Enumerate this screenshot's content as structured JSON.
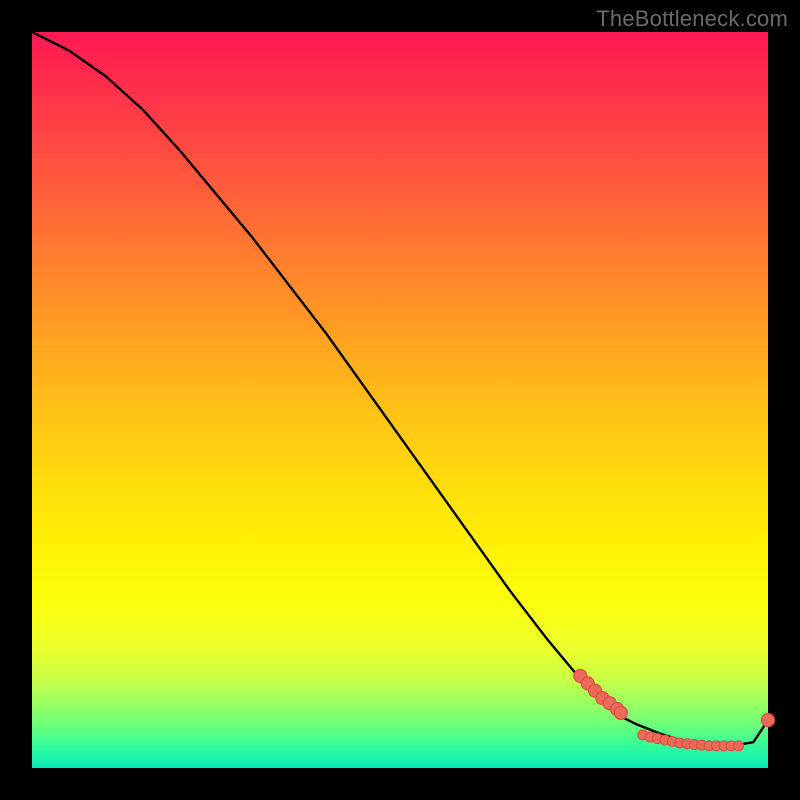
{
  "watermark": "TheBottleneck.com",
  "chart_data": {
    "type": "line",
    "title": "",
    "xlabel": "",
    "ylabel": "",
    "xlim": [
      0,
      100
    ],
    "ylim": [
      0,
      100
    ],
    "grid": false,
    "legend": false,
    "series": [
      {
        "name": "bottleneck-curve",
        "x": [
          0,
          5,
          10,
          15,
          20,
          25,
          30,
          35,
          40,
          45,
          50,
          55,
          60,
          65,
          70,
          75,
          78,
          80,
          82,
          85,
          88,
          90,
          92,
          95,
          98,
          100
        ],
        "y": [
          100,
          97.5,
          94,
          89.5,
          84,
          78,
          72,
          65.5,
          59,
          52,
          45,
          38,
          31,
          24,
          17.5,
          11.5,
          8.5,
          7,
          6,
          4.8,
          3.8,
          3.3,
          3,
          3,
          3.5,
          6.5
        ]
      }
    ],
    "points_cluster_a": {
      "name": "left-marker-cluster",
      "x": [
        74.5,
        75.5,
        76.5,
        77.5,
        78.5,
        79.5,
        80.0
      ],
      "y": [
        12.5,
        11.5,
        10.5,
        9.5,
        8.8,
        8.0,
        7.5
      ]
    },
    "points_cluster_b": {
      "name": "bottom-marker-cluster",
      "x": [
        83,
        84,
        85,
        86,
        87,
        88,
        89,
        90,
        91,
        92,
        93,
        94,
        95,
        96
      ],
      "y": [
        4.5,
        4.2,
        4.0,
        3.8,
        3.6,
        3.4,
        3.3,
        3.2,
        3.1,
        3.0,
        3.0,
        3.0,
        3.0,
        3.0
      ]
    },
    "points_end": {
      "name": "endpoint-marker",
      "x": [
        100
      ],
      "y": [
        6.5
      ]
    },
    "annotation_label": ""
  }
}
